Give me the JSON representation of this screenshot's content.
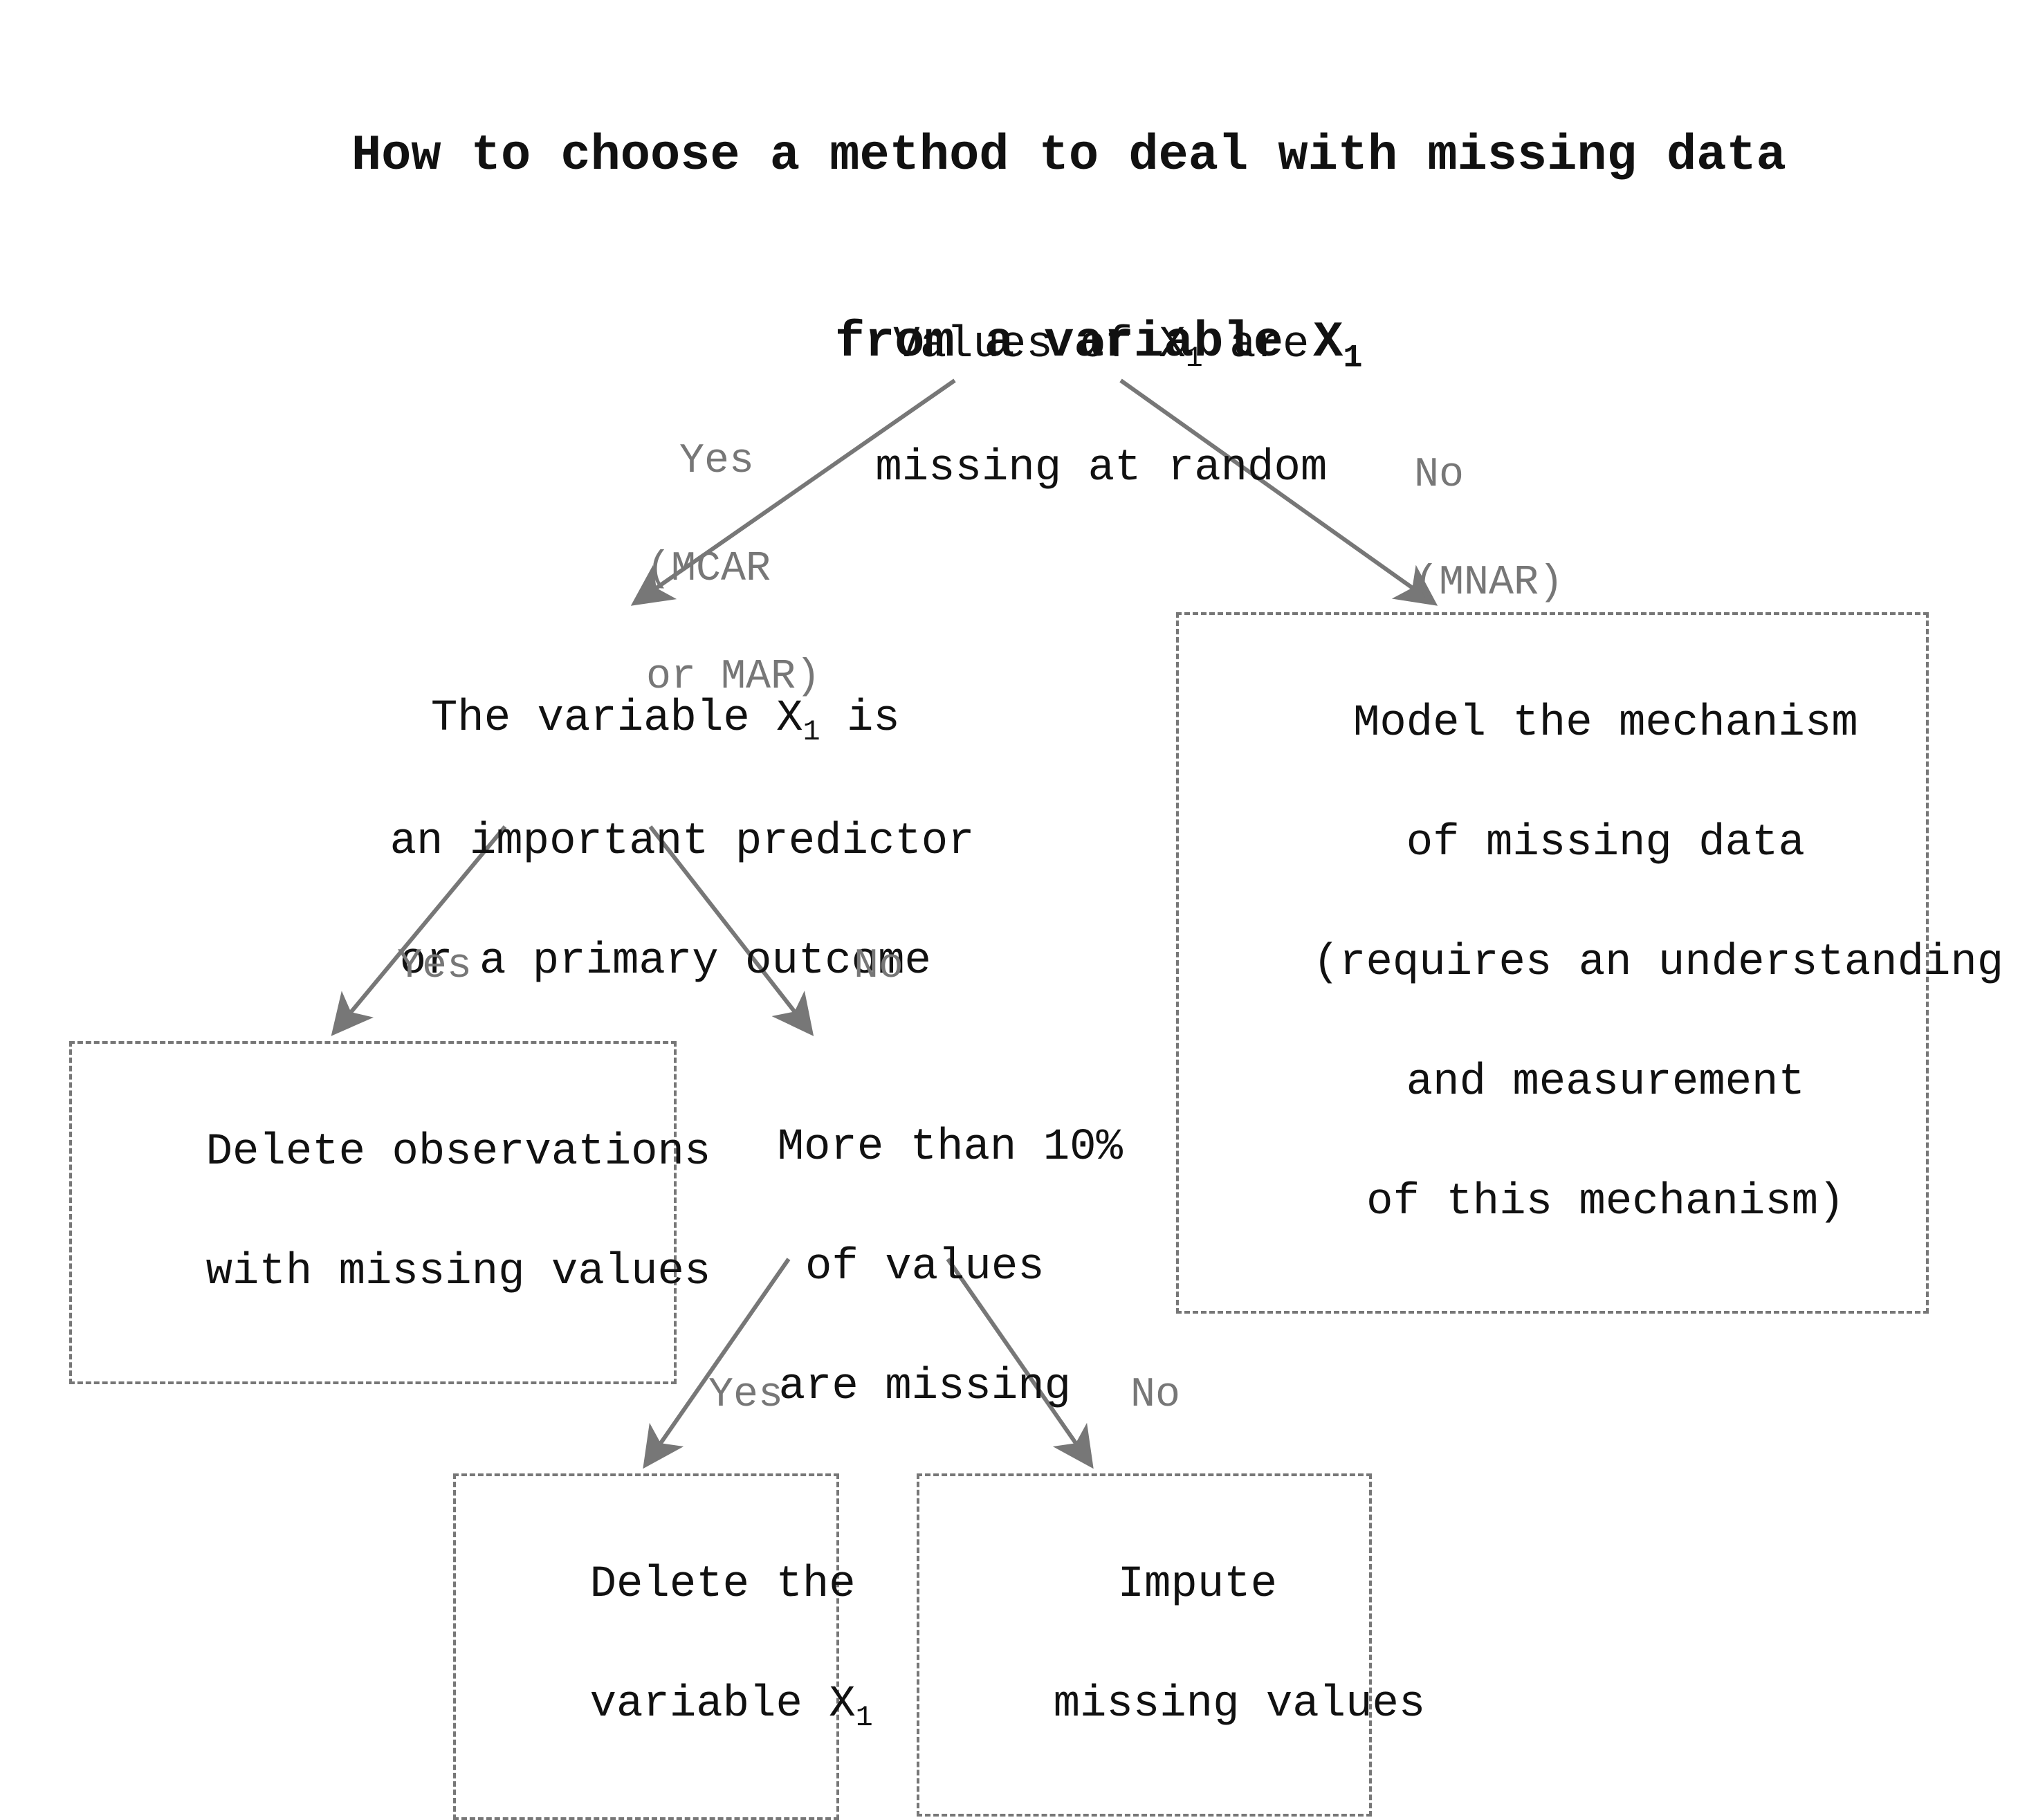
{
  "title_line1": "How to choose a method to deal with missing data",
  "title_line2": "from a variable X",
  "title_sub": "1",
  "root_line1": "Values of X",
  "root_sub": "1",
  "root_line1b": " are",
  "root_line2": "missing at random",
  "root_yes_line1": "Yes",
  "root_yes_line2": "(MCAR",
  "root_yes_line3": "or MAR)",
  "root_no_line1": "No",
  "root_no_line2": "(MNAR)",
  "model_line1": "Model the mechanism",
  "model_line2": "of missing data",
  "model_line3": "(requires an understanding",
  "model_line4": "and measurement",
  "model_line5": "of this mechanism)",
  "important_line1a": "The variable X",
  "important_sub": "1",
  "important_line1b": " is",
  "important_line2": "an important predictor",
  "important_line3": "or a primary outcome",
  "edge_yes": "Yes",
  "edge_no": "No",
  "delete_obs_line1": "Delete observations",
  "delete_obs_line2": "with missing values",
  "more10_line1": "More than 10%",
  "more10_line2": "of values",
  "more10_line3": "are missing",
  "delete_var_line1": "Delete the",
  "delete_var_line2a": "variable X",
  "delete_var_sub": "1",
  "impute_line1": "Impute",
  "impute_line2": "missing values",
  "colors": {
    "text": "#111111",
    "muted": "#777777",
    "arrow": "#777777"
  }
}
